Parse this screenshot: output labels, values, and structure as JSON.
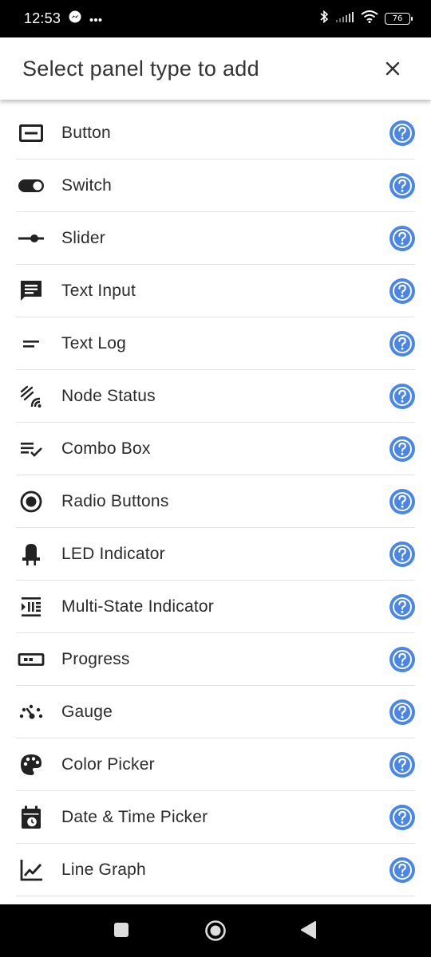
{
  "status_bar": {
    "time": "12:53",
    "battery": "76",
    "icons": [
      "messenger-icon",
      "more-dots-icon",
      "bluetooth-icon",
      "signal-icon",
      "wifi-icon",
      "battery-icon"
    ]
  },
  "header": {
    "title": "Select panel type to add",
    "close_icon": "close-icon"
  },
  "items": [
    {
      "label": "Button",
      "icon": "button-icon"
    },
    {
      "label": "Switch",
      "icon": "toggle-icon"
    },
    {
      "label": "Slider",
      "icon": "slider-icon"
    },
    {
      "label": "Text Input",
      "icon": "text-input-icon"
    },
    {
      "label": "Text Log",
      "icon": "text-log-icon"
    },
    {
      "label": "Node Status",
      "icon": "node-status-icon"
    },
    {
      "label": "Combo Box",
      "icon": "combo-box-icon"
    },
    {
      "label": "Radio Buttons",
      "icon": "radio-button-icon"
    },
    {
      "label": "LED Indicator",
      "icon": "led-icon"
    },
    {
      "label": "Multi-State Indicator",
      "icon": "multi-state-icon"
    },
    {
      "label": "Progress",
      "icon": "progress-icon"
    },
    {
      "label": "Gauge",
      "icon": "gauge-icon"
    },
    {
      "label": "Color Picker",
      "icon": "palette-icon"
    },
    {
      "label": "Date & Time Picker",
      "icon": "calendar-icon"
    },
    {
      "label": "Line Graph",
      "icon": "line-graph-icon"
    }
  ],
  "help_icon": "help-icon",
  "colors": {
    "help": "#4a86e8",
    "status_bar": "#000000",
    "icon": "#222222"
  },
  "nav_bar": {
    "buttons": [
      "recents-button",
      "home-button",
      "back-button"
    ]
  }
}
